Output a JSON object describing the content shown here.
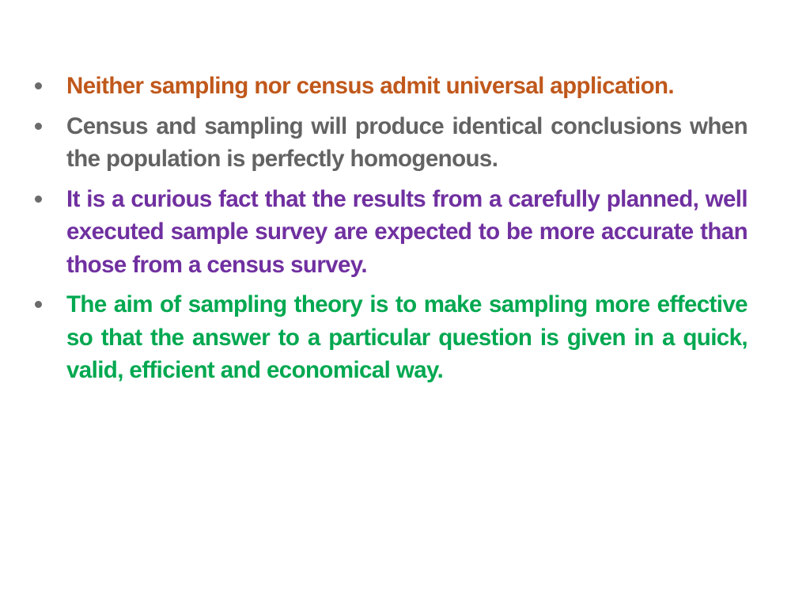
{
  "slide": {
    "bullets": [
      {
        "text": "Neither sampling nor census admit universal application.",
        "color": "#c0581b"
      },
      {
        "text": "Census and sampling will produce identical conclusions when the population is perfectly homogenous.",
        "color": "#636363"
      },
      {
        "text": "It is a curious fact that the results from a carefully planned, well executed sample survey are expected to be more accurate than those from a census survey.",
        "color": "#7030a0"
      },
      {
        "text": "The aim of sampling theory is to make sampling more effective so that the answer to a particular question is given in a quick, valid, efficient and economical way.",
        "color": "#00a850"
      }
    ],
    "bullet_marker_color": "#6b6b6b"
  }
}
